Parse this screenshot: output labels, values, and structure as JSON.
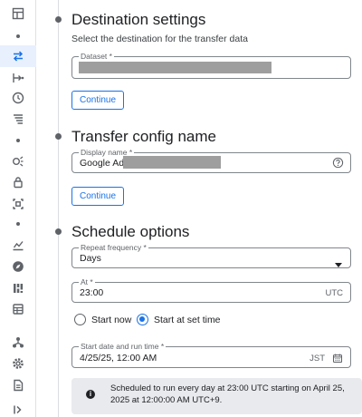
{
  "sections": {
    "destination": {
      "title": "Destination settings",
      "subtitle": "Select the destination for the transfer data",
      "dataset_label": "Dataset *",
      "continue_label": "Continue"
    },
    "config_name": {
      "title": "Transfer config name",
      "display_name_label": "Display name *",
      "display_name_value": "Google Ads",
      "continue_label": "Continue"
    },
    "schedule": {
      "title": "Schedule options",
      "repeat_label": "Repeat frequency *",
      "repeat_value": "Days",
      "at_label": "At *",
      "at_value": "23:00",
      "at_suffix": "UTC",
      "radio_start_now": "Start now",
      "radio_start_at_set_time": "Start at set time",
      "selected_radio": "start_at_set_time",
      "start_label": "Start date and run time *",
      "start_value": "4/25/25, 12:00 AM",
      "start_suffix": "JST",
      "info_text": "Scheduled to run every day at 23:00 UTC starting on April 25, 2025 at 12:00:00 AM UTC+9."
    }
  },
  "colors": {
    "accent": "#1a73e8",
    "active_rail_bg": "#e8f0fe",
    "info_bg": "#e8eaed",
    "redaction": "#9e9e9e"
  },
  "icons": {
    "rail": [
      "dashboard-icon",
      "transfers-icon",
      "migration-icon",
      "scheduled-queries-icon",
      "pipelines-icon",
      "analytics-hub-icon",
      "policy-tags-icon",
      "sharing-icon",
      "monitoring-icon",
      "explore-icon",
      "capacity-icon",
      "admin-icon",
      "release-notes-icon",
      "settings-icon",
      "docs-icon",
      "expand-icon"
    ]
  }
}
